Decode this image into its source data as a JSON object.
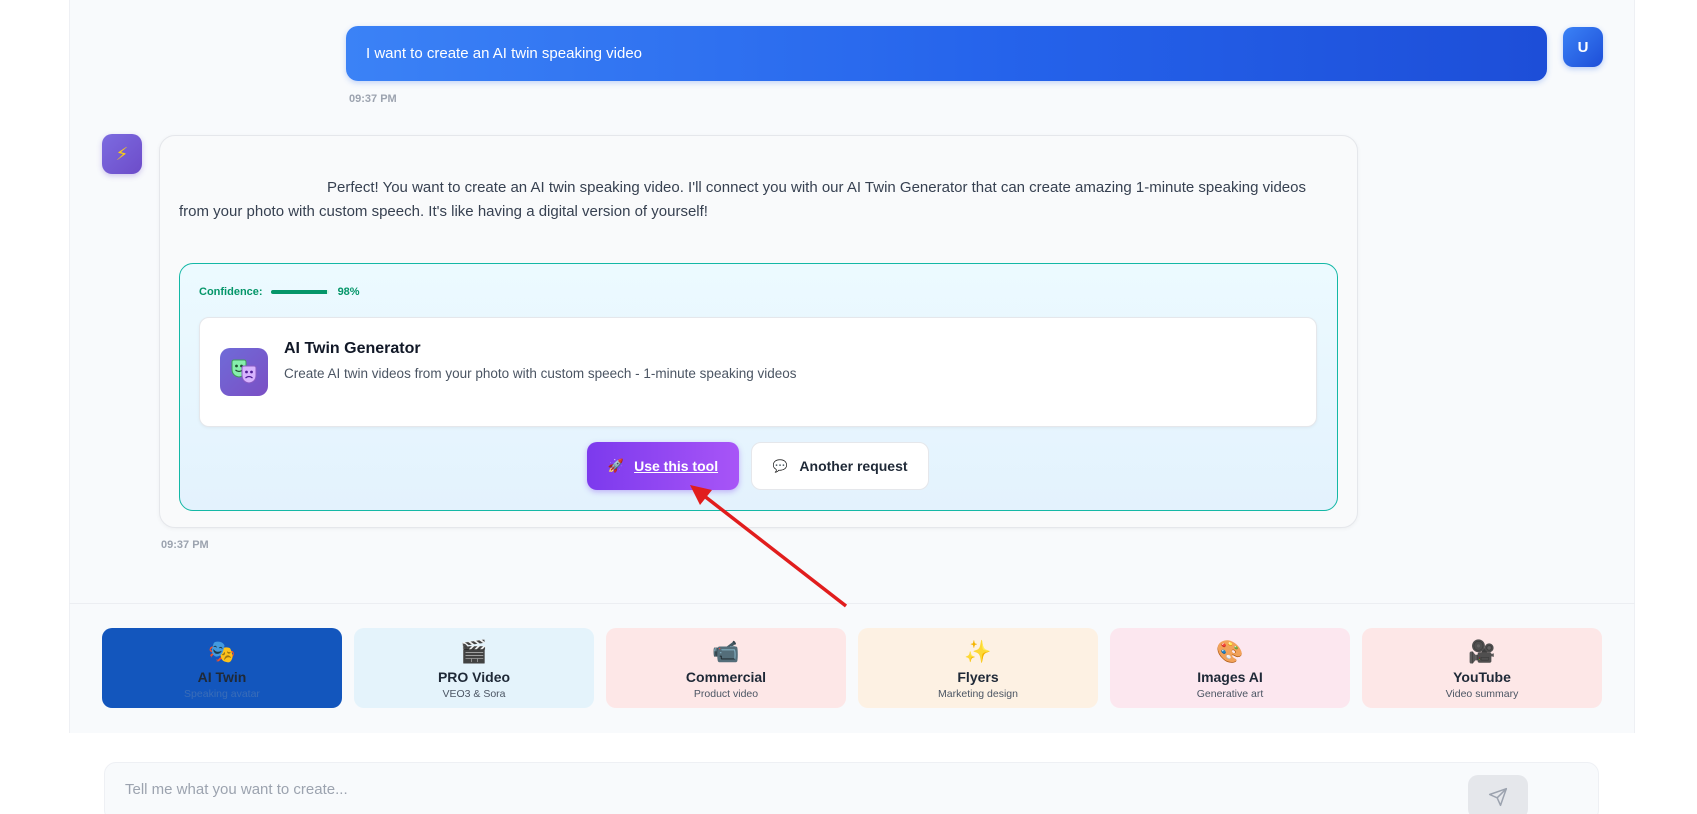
{
  "conversation": {
    "user_message": {
      "text": "I want to create an AI twin speaking video",
      "avatar_letter": "U",
      "time": "09:37 PM"
    },
    "bot_message": {
      "avatar_icon": "lightning-icon",
      "avatar_glyph": "⚡",
      "text": "Perfect! You want to create an AI twin speaking video. I'll connect you with our AI Twin Generator that can create amazing 1-minute speaking videos from your photo with custom speech. It's like having a digital version of yourself!",
      "time": "09:37 PM",
      "recommendation": {
        "confidence_label": "Confidence:",
        "confidence_value": "98%",
        "confidence_fraction": 0.98,
        "tool": {
          "icon": "theater-masks-icon",
          "name": "AI Twin Generator",
          "description": "Create AI twin videos from your photo with custom speech - 1-minute speaking videos"
        },
        "use_button": {
          "icon": "rocket-icon",
          "glyph": "🚀",
          "label": "Use this tool"
        },
        "another_button": {
          "icon": "speech-bubble-icon",
          "glyph": "💬",
          "label": "Another request"
        }
      }
    }
  },
  "tool_chips": [
    {
      "id": "ai-twin",
      "glyph": "🎭",
      "icon": "theater-masks-icon",
      "title": "AI Twin",
      "subtitle": "Speaking avatar",
      "active": true,
      "bg": "#1356bd"
    },
    {
      "id": "pro-video",
      "glyph": "🎬",
      "icon": "clapperboard-icon",
      "title": "PRO Video",
      "subtitle": "VEO3 & Sora",
      "active": false,
      "bg": "#e4f3fb"
    },
    {
      "id": "commercial",
      "glyph": "📹",
      "icon": "video-camera-icon",
      "title": "Commercial",
      "subtitle": "Product video",
      "active": false,
      "bg": "#fde7e7"
    },
    {
      "id": "flyers",
      "glyph": "✨",
      "icon": "sparkles-icon",
      "title": "Flyers",
      "subtitle": "Marketing design",
      "active": false,
      "bg": "#fdf1e3"
    },
    {
      "id": "images-ai",
      "glyph": "🎨",
      "icon": "palette-icon",
      "title": "Images AI",
      "subtitle": "Generative art",
      "active": false,
      "bg": "#fce7ef"
    },
    {
      "id": "youtube",
      "glyph": "🎥",
      "icon": "movie-camera-icon",
      "title": "YouTube",
      "subtitle": "Video summary",
      "active": false,
      "bg": "#fde7e7"
    }
  ],
  "composer": {
    "placeholder": "Tell me what you want to create...",
    "value": "",
    "send_icon": "send-icon"
  },
  "colors": {
    "accent_blue": "#2563eb",
    "accent_purple": "#7c3aed",
    "confidence_green": "#059669",
    "annotation_red": "#e11d1d"
  }
}
